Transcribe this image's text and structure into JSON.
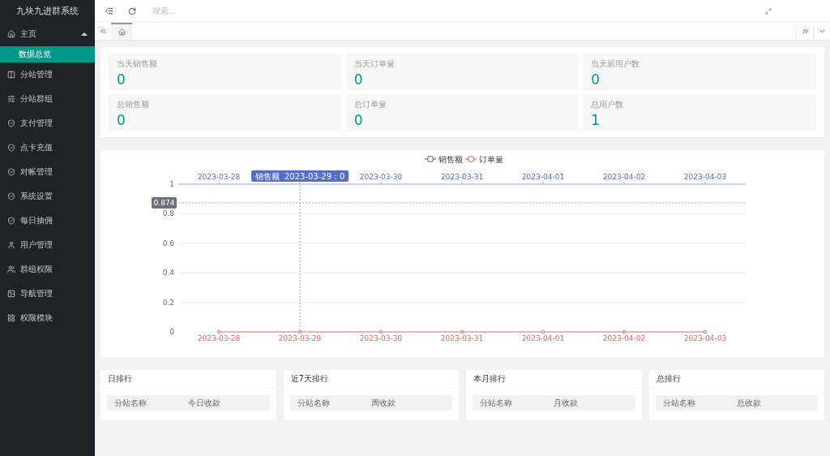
{
  "sidebar": {
    "title": "九块九进群系统",
    "items": [
      {
        "label": "主页",
        "expanded": true,
        "selected": false,
        "children": [
          {
            "label": "数据总览",
            "selected": true
          }
        ]
      },
      {
        "label": "分站管理",
        "selected": false
      },
      {
        "label": "分站群组",
        "selected": false
      },
      {
        "label": "支付管理",
        "selected": false
      },
      {
        "label": "点卡充值",
        "selected": false
      },
      {
        "label": "对帐管理",
        "selected": false
      },
      {
        "label": "系统设置",
        "selected": false
      },
      {
        "label": "每日抽佣",
        "selected": false
      },
      {
        "label": "用户管理",
        "selected": false
      },
      {
        "label": "群组权限",
        "selected": false
      },
      {
        "label": "导航管理",
        "selected": false
      },
      {
        "label": "权限模块",
        "selected": false
      }
    ]
  },
  "header": {
    "search": {
      "placeholder": "搜索..."
    }
  },
  "tabs": [
    {
      "kind": "home",
      "selected": true
    }
  ],
  "stats": [
    {
      "label": "当天销售额",
      "value": "0"
    },
    {
      "label": "当天订单量",
      "value": "0"
    },
    {
      "label": "当天新用户数",
      "value": "0"
    },
    {
      "label": "总销售额",
      "value": "0"
    },
    {
      "label": "总订单量",
      "value": "0"
    },
    {
      "label": "总用户数",
      "value": "1"
    }
  ],
  "chart": {
    "chart_data": {
      "type": "line",
      "categories": [
        "2023-03-28",
        "2023-03-29",
        "2023-03-30",
        "2023-03-31",
        "2023-04-01",
        "2023-04-02",
        "2023-04-03"
      ],
      "series": [
        {
          "name": "销售额",
          "color": "#5470c6",
          "values": [
            null,
            null,
            null,
            null,
            null,
            null,
            null
          ]
        },
        {
          "name": "订单量",
          "color": "#ee6666",
          "values": [
            0,
            0,
            0,
            0,
            0,
            0,
            0
          ],
          "marker": "circle"
        }
      ],
      "ylim": [
        0,
        1
      ],
      "yticks": [
        0,
        0.2,
        0.4,
        0.6,
        0.8,
        1
      ],
      "grid": true,
      "legend": true,
      "ref_lines": [
        {
          "axis": "x",
          "value": "2023-03-29",
          "label": "销售额  2023-03-29：0"
        },
        {
          "axis": "y",
          "value": 0.874,
          "label": "0.874"
        }
      ]
    }
  },
  "rankings": [
    {
      "title": "日排行",
      "columns": [
        "分站名称",
        "今日收款"
      ]
    },
    {
      "title": "近7天排行",
      "columns": [
        "分站名称",
        "周收款"
      ]
    },
    {
      "title": "本月排行",
      "columns": [
        "分站名称",
        "月收款"
      ]
    },
    {
      "title": "总排行",
      "columns": [
        "分站名称",
        "总收款"
      ]
    }
  ]
}
